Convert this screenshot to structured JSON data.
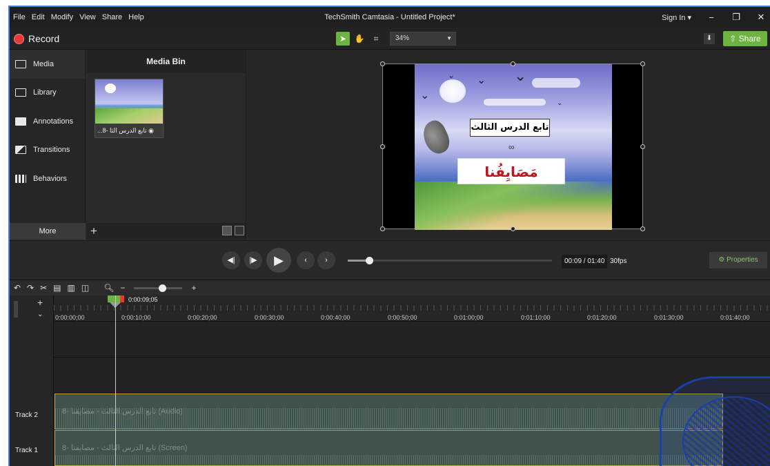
{
  "menu": [
    "File",
    "Edit",
    "Modify",
    "View",
    "Share",
    "Help"
  ],
  "title": "TechSmith Camtasia - Untitled Project*",
  "window": {
    "signin": "Sign In ▾"
  },
  "toolbar": {
    "record": "Record",
    "zoom": "34%",
    "share": "Share"
  },
  "nav": [
    {
      "label": "Media",
      "icon": "film-icon"
    },
    {
      "label": "Library",
      "icon": "books-icon"
    },
    {
      "label": "Annotations",
      "icon": "speech-bubble-icon"
    },
    {
      "label": "Transitions",
      "icon": "transition-icon"
    },
    {
      "label": "Behaviors",
      "icon": "behaviors-icon"
    }
  ],
  "nav_more": "More",
  "bin": {
    "title": "Media Bin",
    "item_label": "...تابع الدرس الثا -8 ◉"
  },
  "canvas": {
    "text1": "تابع الدرس الثالث",
    "text2": "∞",
    "text3": "مَصَايِفُنا"
  },
  "player": {
    "time": "00:09 / 01:40",
    "fps": "30fps",
    "properties": "Properties"
  },
  "playhead": {
    "time": "0:00:09;05",
    "progress_fraction": 0.092
  },
  "ruler": [
    "0:00:00;00",
    "0:00:10;00",
    "0:00:20;00",
    "0:00:30;00",
    "0:00:40;00",
    "0:00:50;00",
    "0:01:00;00",
    "0:01:10;00",
    "0:01:20;00",
    "0:01:30;00",
    "0:01:40;00"
  ],
  "tracks": [
    {
      "name": "Track 2",
      "clip": "8- تابع الدرس الثالث - مصايفنا (Audio)"
    },
    {
      "name": "Track 1",
      "clip": "8- تابع الدرس الثالث - مصايفنا (Screen)"
    }
  ],
  "colors": {
    "accent": "#6cb33f",
    "record": "#e53935",
    "clip_border": "#c8a23a"
  }
}
